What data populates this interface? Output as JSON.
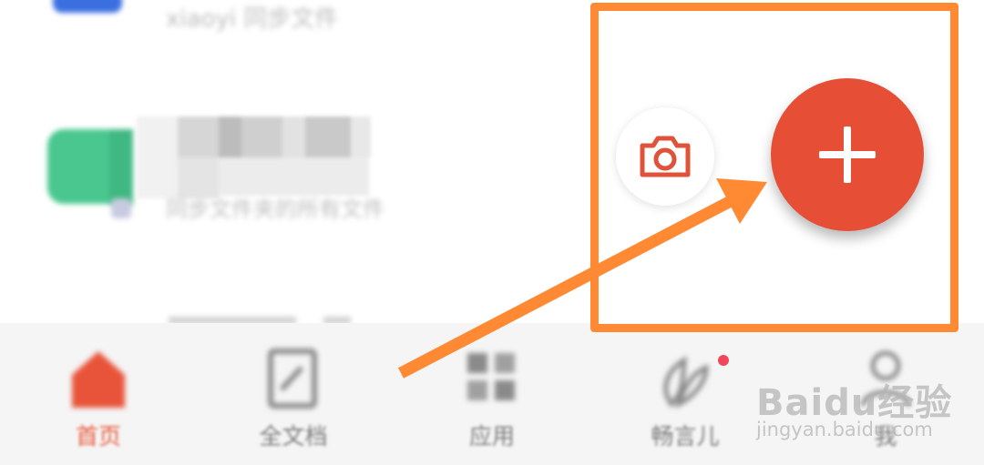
{
  "list": {
    "item1_subtitle": "xiaoyi 同步文件",
    "item2_subtitle": "同步文件夹的所有文件"
  },
  "tabs": [
    {
      "label": "首页",
      "icon": "home-icon",
      "active": true
    },
    {
      "label": "全文档",
      "icon": "document-icon",
      "active": false
    },
    {
      "label": "应用",
      "icon": "apps-grid-icon",
      "active": false
    },
    {
      "label": "畅言儿",
      "icon": "leaf-icon",
      "active": false,
      "badge": true
    },
    {
      "label": "我",
      "icon": "person-icon",
      "active": false
    }
  ],
  "actions": {
    "camera_icon": "camera-icon",
    "add_icon": "plus-icon"
  },
  "watermark": {
    "brand": "Baidu经验",
    "url": "jingyan.baidu.com"
  },
  "colors": {
    "accent": "#e64e36",
    "highlight": "#ff8a33",
    "badge": "#f0485a",
    "green_icon": "#49c78f",
    "blue_icon": "#3b6fe0"
  }
}
